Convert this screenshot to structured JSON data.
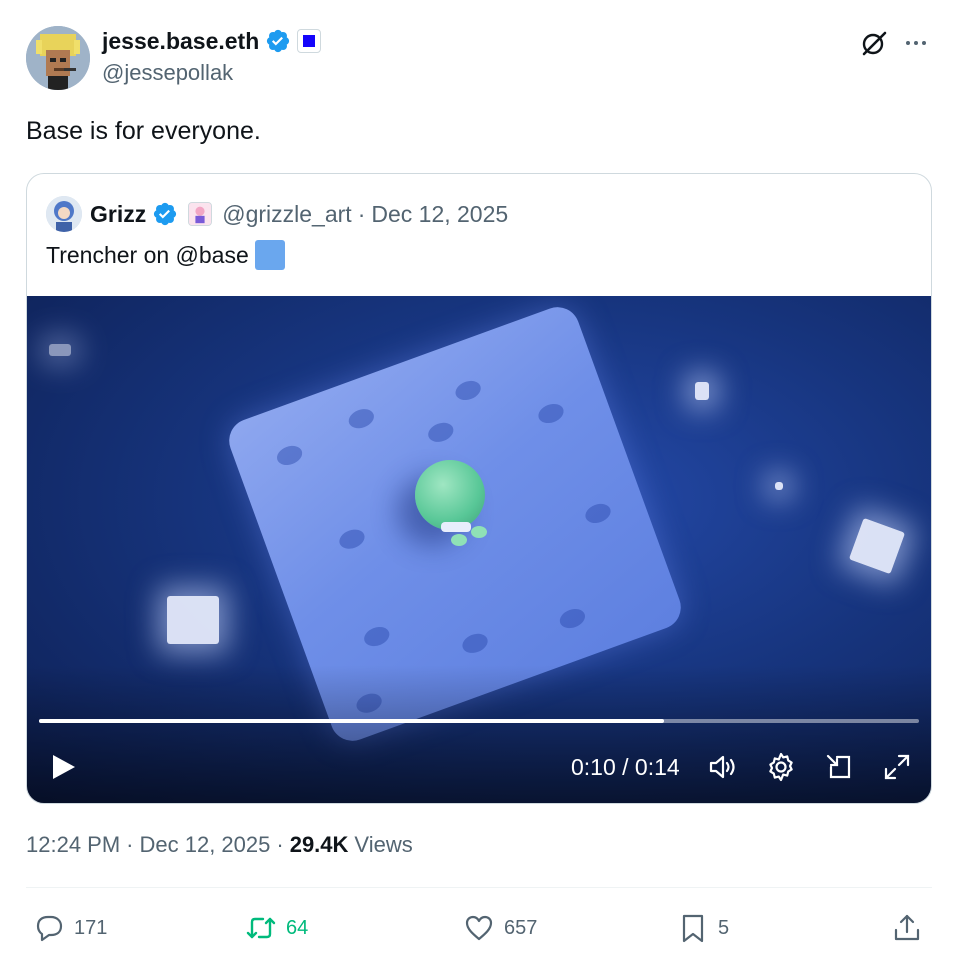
{
  "author": {
    "display_name": "jesse.base.eth",
    "handle": "@jessepollak",
    "verified": true,
    "affiliate_badge_color": "#1404fb"
  },
  "icons": {
    "verified": "verified-check-icon",
    "grok": "grok-icon",
    "more": "more-icon",
    "play": "play-icon",
    "volume": "volume-icon",
    "settings": "settings-gear-icon",
    "pip": "picture-in-picture-icon",
    "fullscreen": "fullscreen-icon",
    "reply": "reply-bubble-icon",
    "retweet": "retweet-arrows-icon",
    "like": "heart-icon",
    "bookmark": "bookmark-icon",
    "share": "share-upload-icon"
  },
  "tweet": {
    "text": "Base is for everyone.",
    "time": "12:24 PM",
    "date": "Dec 12, 2025",
    "views_count": "29.4K",
    "views_label": "Views",
    "separator": "·"
  },
  "quote": {
    "display_name": "Grizz",
    "handle": "@grizzle_art",
    "separator": "·",
    "date": "Dec 12, 2025",
    "text": "Trencher on @base",
    "video": {
      "current_time": "0:10",
      "duration": "0:14",
      "time_display": "0:10 / 0:14",
      "progress_fraction": 0.71
    }
  },
  "actions": {
    "replies": "171",
    "retweets": "64",
    "likes": "657",
    "bookmarks": "5"
  },
  "colors": {
    "accent_blue": "#1d9bf0",
    "retweet_green": "#00ba7c",
    "secondary_text": "#536471",
    "primary_text": "#0f1419",
    "border": "#cfd9de",
    "emoji_blue_square": "#6aa7ee"
  }
}
